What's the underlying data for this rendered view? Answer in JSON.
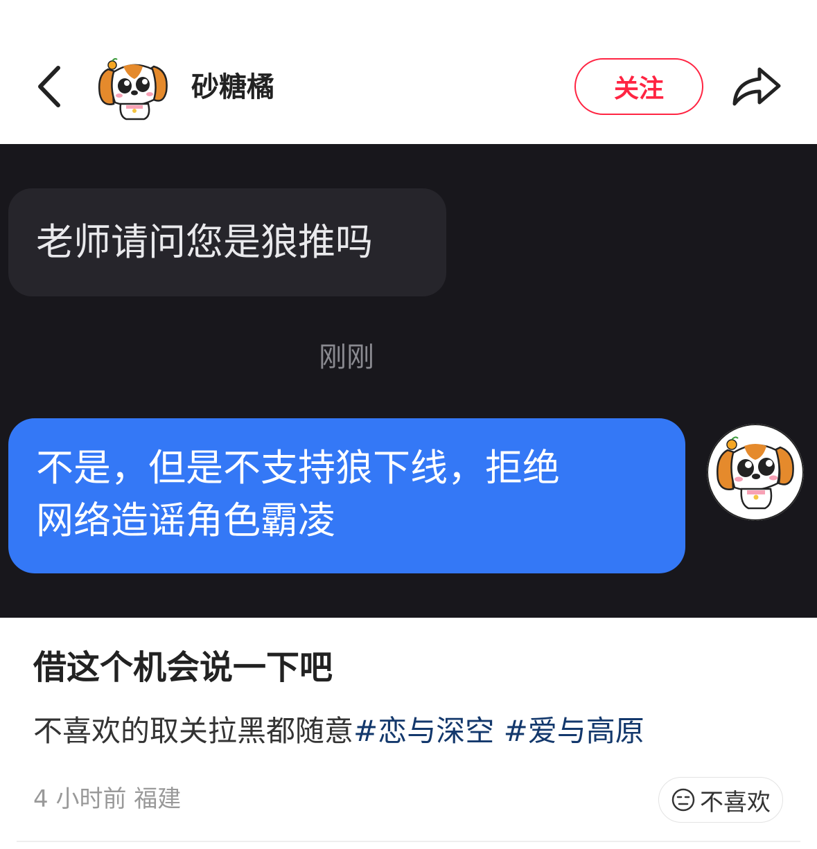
{
  "header": {
    "author_name": "砂糖橘",
    "follow_label": "关注"
  },
  "chat": {
    "incoming_message": "老师请问您是狼推吗",
    "timestamp": "刚刚",
    "outgoing_message_lines": [
      "不是，但是不支持狼下线，拒绝",
      "网络造谣角色霸凌"
    ]
  },
  "post": {
    "title": "借这个机会说一下吧",
    "content_text": "不喜欢的取关拉黑都随意",
    "tags": [
      "#恋与深空",
      "#爱与高原"
    ],
    "time": "4 小时前",
    "location": "福建",
    "dislike_label": "不喜欢"
  },
  "colors": {
    "accent": "#ff2442",
    "bubble_out": "#3478f6",
    "chat_bg": "#18171c",
    "tag": "#13386c"
  },
  "icons": {
    "back": "chevron-left-icon",
    "share": "share-arrow-icon",
    "dislike": "neutral-face-icon"
  }
}
